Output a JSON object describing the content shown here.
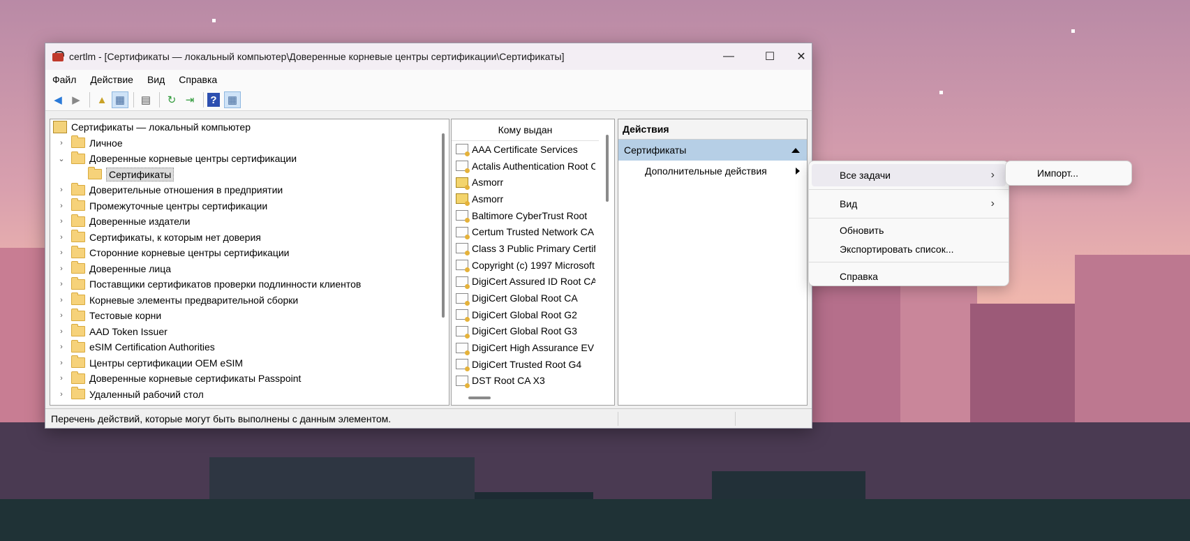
{
  "window": {
    "title": "certlm - [Сертификаты — локальный компьютер\\Доверенные корневые центры сертификации\\Сертификаты]",
    "minimize": "—",
    "maximize": "☐",
    "close": "✕"
  },
  "menu": [
    "Файл",
    "Действие",
    "Вид",
    "Справка"
  ],
  "toolbar": {
    "back": "◀",
    "forward": "▶",
    "up": "▲",
    "show_tree": "▦",
    "properties": "▤",
    "refresh": "↻",
    "export": "⇥",
    "help": "?",
    "show_actions": "▦"
  },
  "tree": {
    "root": "Сертификаты — локальный компьютер",
    "items": [
      {
        "label": "Личное",
        "chev": "›"
      },
      {
        "label": "Доверенные корневые центры сертификации",
        "chev": "⌄"
      },
      {
        "label": "Сертификаты",
        "chev": ""
      },
      {
        "label": "Доверительные отношения в предприятии",
        "chev": "›"
      },
      {
        "label": "Промежуточные центры сертификации",
        "chev": "›"
      },
      {
        "label": "Доверенные издатели",
        "chev": "›"
      },
      {
        "label": "Сертификаты, к которым нет доверия",
        "chev": "›"
      },
      {
        "label": "Сторонние корневые центры сертификации",
        "chev": "›"
      },
      {
        "label": "Доверенные лица",
        "chev": "›"
      },
      {
        "label": "Поставщики сертификатов проверки подлинности клиентов",
        "chev": "›"
      },
      {
        "label": "Корневые элементы предварительной сборки",
        "chev": "›"
      },
      {
        "label": "Тестовые корни",
        "chev": "›"
      },
      {
        "label": "AAD Token Issuer",
        "chev": "›"
      },
      {
        "label": "eSIM Certification Authorities",
        "chev": "›"
      },
      {
        "label": "Центры сертификации OEM eSIM",
        "chev": "›"
      },
      {
        "label": "Доверенные корневые сертификаты Passpoint",
        "chev": "›"
      },
      {
        "label": "Удаленный рабочий стол",
        "chev": "›"
      }
    ]
  },
  "list": {
    "header": "Кому выдан",
    "rows": [
      "AAA Certificate Services",
      "Actalis Authentication Root C",
      "Asmorr",
      "Asmorr",
      "Baltimore CyberTrust Root",
      "Certum Trusted Network CA",
      "Class 3 Public Primary Certifi",
      "Copyright (c) 1997 Microsoft",
      "DigiCert Assured ID Root CA",
      "DigiCert Global Root CA",
      "DigiCert Global Root G2",
      "DigiCert Global Root G3",
      "DigiCert High Assurance EV",
      "DigiCert Trusted Root G4",
      "DST Root CA X3"
    ]
  },
  "actions": {
    "header": "Действия",
    "group": "Сертификаты",
    "more": "Дополнительные действия"
  },
  "status": "Перечень действий, которые могут быть выполнены с данным элементом.",
  "context_menu": {
    "items": [
      "Все задачи",
      "Вид",
      "Обновить",
      "Экспортировать список...",
      "Справка"
    ],
    "arrow": "›"
  },
  "submenu": {
    "items": [
      "Импорт..."
    ]
  }
}
